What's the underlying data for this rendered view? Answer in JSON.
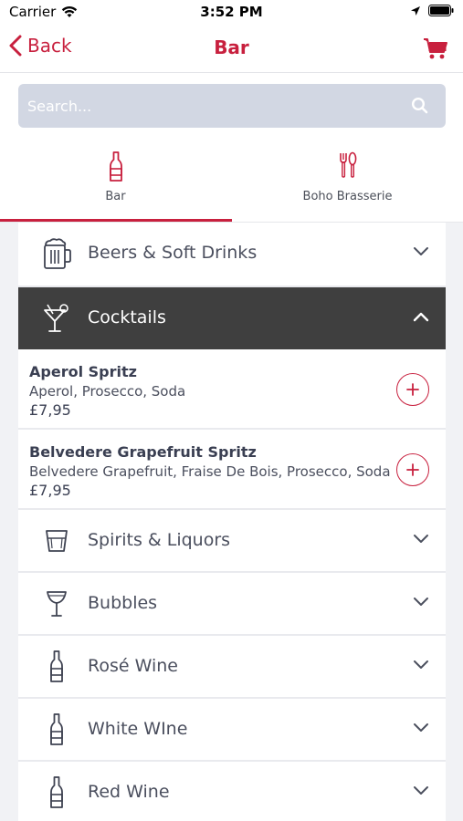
{
  "status_bar": {
    "carrier": "Carrier",
    "time": "3:52 PM"
  },
  "nav": {
    "back_label": "Back",
    "title": "Bar"
  },
  "search": {
    "placeholder": "Search..."
  },
  "tabs": [
    {
      "label": "Bar",
      "icon": "bottle-icon",
      "selected": true
    },
    {
      "label": "Boho Brasserie",
      "icon": "cutlery-icon",
      "selected": false
    }
  ],
  "categories": [
    {
      "label": "Beers & Soft Drinks",
      "icon": "beer-mug-icon"
    },
    {
      "label": "Cocktails",
      "icon": "cocktail-glass-icon",
      "expanded": true
    },
    {
      "label": "Spirits & Liquors",
      "icon": "tumbler-icon"
    },
    {
      "label": "Bubbles",
      "icon": "coupe-glass-icon"
    },
    {
      "label": "Rosé Wine",
      "icon": "wine-bottle-icon"
    },
    {
      "label": "White WIne",
      "icon": "wine-bottle-icon"
    },
    {
      "label": "Red Wine",
      "icon": "wine-bottle-icon"
    }
  ],
  "cocktail_items": [
    {
      "name": "Aperol Spritz",
      "description": "Aperol, Prosecco, Soda",
      "price": "£7,95"
    },
    {
      "name": "Belvedere Grapefruit Spritz",
      "description": "Belvedere Grapefruit, Fraise De Bois, Prosecco, Soda",
      "price": "£7,95"
    }
  ],
  "colors": {
    "accent": "#c8203e",
    "expanded_header": "#3f3f3f",
    "search_bg": "#d2d7e3",
    "page_bg": "#f1f2f5"
  }
}
